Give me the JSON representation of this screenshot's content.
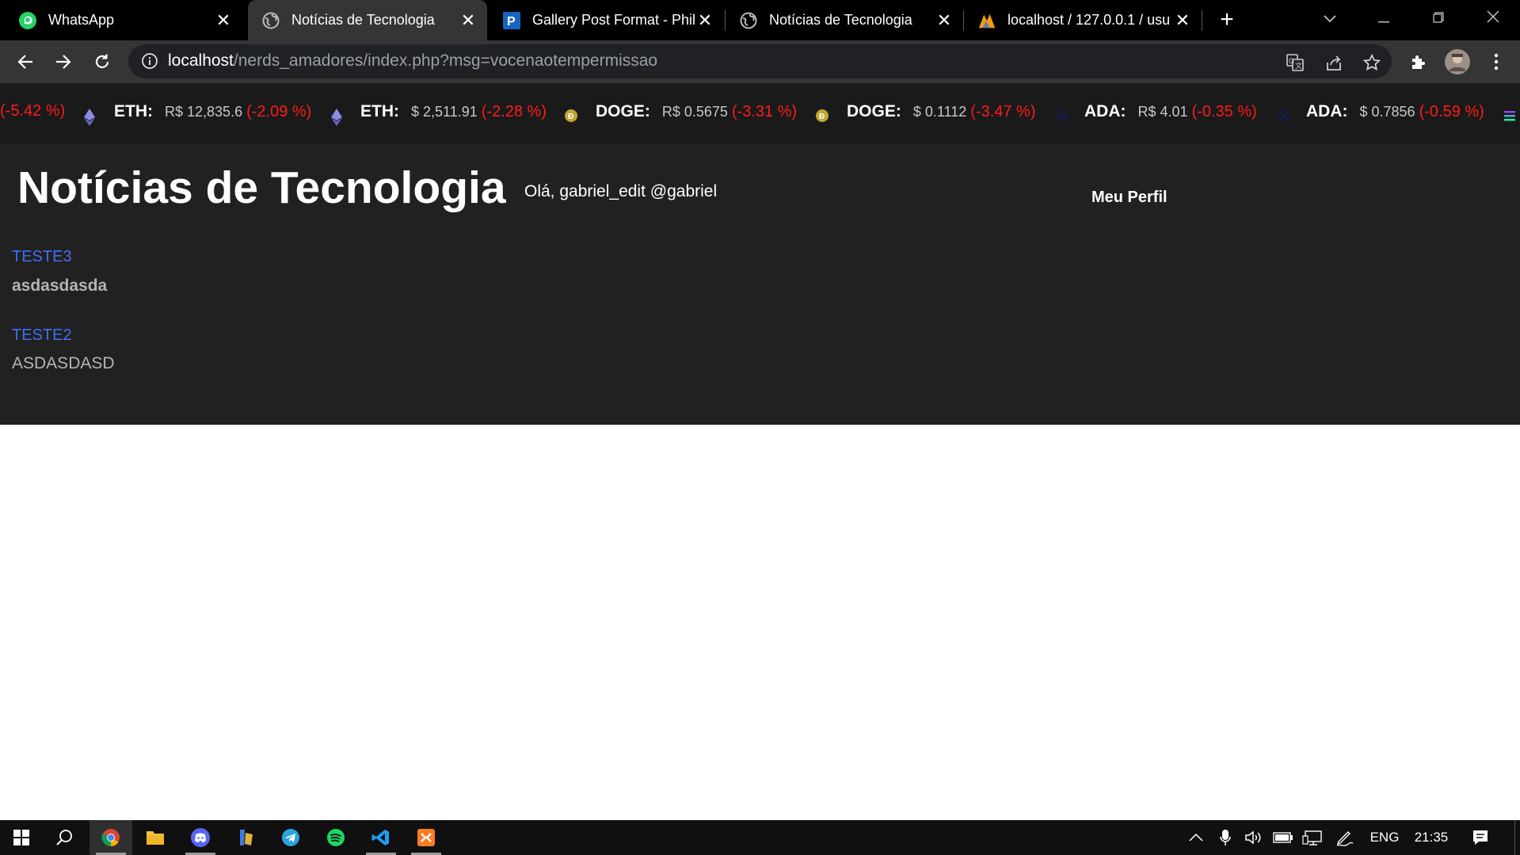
{
  "browser": {
    "tabs": [
      {
        "title": "WhatsApp",
        "icon": "whatsapp-icon",
        "active": false
      },
      {
        "title": "Notícias de Tecnologia",
        "icon": "globe-icon",
        "active": true
      },
      {
        "title": "Gallery Post Format - Phil",
        "icon": "p-icon",
        "active": false
      },
      {
        "title": "Notícias de Tecnologia",
        "icon": "globe-icon",
        "active": false
      },
      {
        "title": "localhost / 127.0.0.1 / usu",
        "icon": "phpmyadmin-icon",
        "active": false
      }
    ],
    "new_tab": "+",
    "address": {
      "host": "localhost",
      "path": "/nerds_amadores/index.php?msg=vocenaotempermissao"
    }
  },
  "ticker": [
    {
      "symbol": "",
      "price": "",
      "change": "(-5.42 %)",
      "coin": ""
    },
    {
      "symbol": "ETH:",
      "price": "R$ 12,835.6",
      "change": "(-2.09 %)",
      "coin": "eth"
    },
    {
      "symbol": "ETH:",
      "price": "$ 2,511.91",
      "change": "(-2.28 %)",
      "coin": "eth"
    },
    {
      "symbol": "DOGE:",
      "price": "R$ 0.5675",
      "change": "(-3.31 %)",
      "coin": "doge"
    },
    {
      "symbol": "DOGE:",
      "price": "$ 0.1112",
      "change": "(-3.47 %)",
      "coin": "doge"
    },
    {
      "symbol": "ADA:",
      "price": "R$ 4.01",
      "change": "(-0.35 %)",
      "coin": "ada"
    },
    {
      "symbol": "ADA:",
      "price": "$ 0.7856",
      "change": "(-0.59 %)",
      "coin": "ada"
    }
  ],
  "header": {
    "site_title": "Notícias de Tecnologia",
    "greeting": "Olá, gabriel_edit @gabriel",
    "profile_link": "Meu Perfil"
  },
  "posts": [
    {
      "title": "TESTE3",
      "body": "asdasdasda"
    },
    {
      "title": "TESTE2",
      "body": "ASDASDASD"
    }
  ],
  "taskbar": {
    "language": "ENG",
    "time": "21:35"
  },
  "colors": {
    "ticker_bg": "#1a1a1a",
    "content_bg": "#212121",
    "link_blue": "#3f6ff5",
    "negative_red": "#ff1a1a"
  }
}
